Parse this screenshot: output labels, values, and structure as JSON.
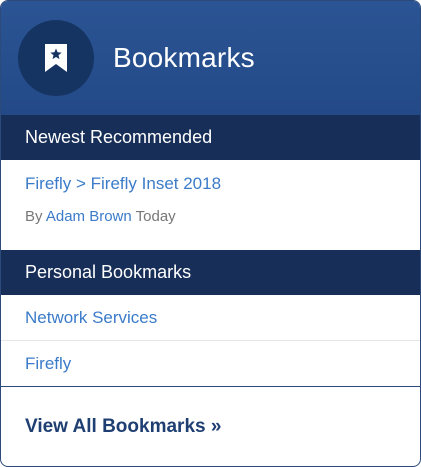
{
  "header": {
    "title": "Bookmarks",
    "icon": "bookmark-star-icon"
  },
  "newest": {
    "heading": "Newest Recommended",
    "item": {
      "link": "Firefly > Firefly Inset 2018",
      "by_label": "By",
      "author": "Adam Brown",
      "time": "Today"
    }
  },
  "personal": {
    "heading": "Personal Bookmarks",
    "items": [
      {
        "label": "Network Services"
      },
      {
        "label": "Firefly"
      }
    ]
  },
  "footer": {
    "view_all": "View All Bookmarks »"
  },
  "colors": {
    "header_bg": "#234a87",
    "icon_circle": "#163462",
    "section_bg": "#172f58",
    "link": "#3b7bc9",
    "footer_link": "#1f3f73"
  }
}
